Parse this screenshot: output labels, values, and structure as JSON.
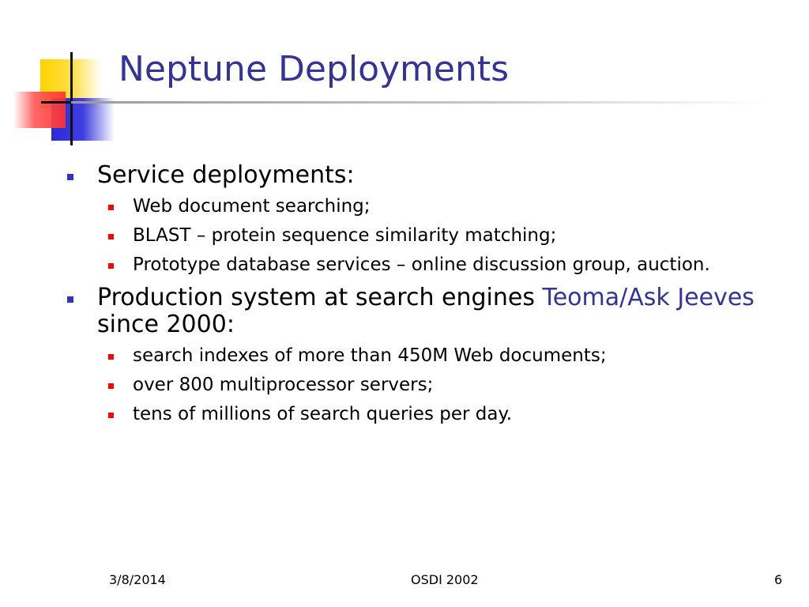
{
  "title": "Neptune Deployments",
  "bullets": [
    {
      "text": "Service deployments:",
      "highlight": "",
      "tail": "",
      "sub": [
        "Web document searching;",
        "BLAST – protein sequence similarity matching;",
        "Prototype database services – online discussion group, auction."
      ]
    },
    {
      "text": "Production system at search engines ",
      "highlight": "Teoma/Ask Jeeves",
      "tail": "since 2000:",
      "sub": [
        "search indexes of more than 450M Web documents;",
        "over 800 multiprocessor servers;",
        "tens of millions of search queries per day."
      ]
    }
  ],
  "footer": {
    "date": "3/8/2014",
    "center": "OSDI 2002",
    "page": "6"
  },
  "colors": {
    "title": "#333399",
    "level1_bullet": "#3333cc",
    "level2_bullet": "#ff0000",
    "highlight_text": "#333399"
  }
}
